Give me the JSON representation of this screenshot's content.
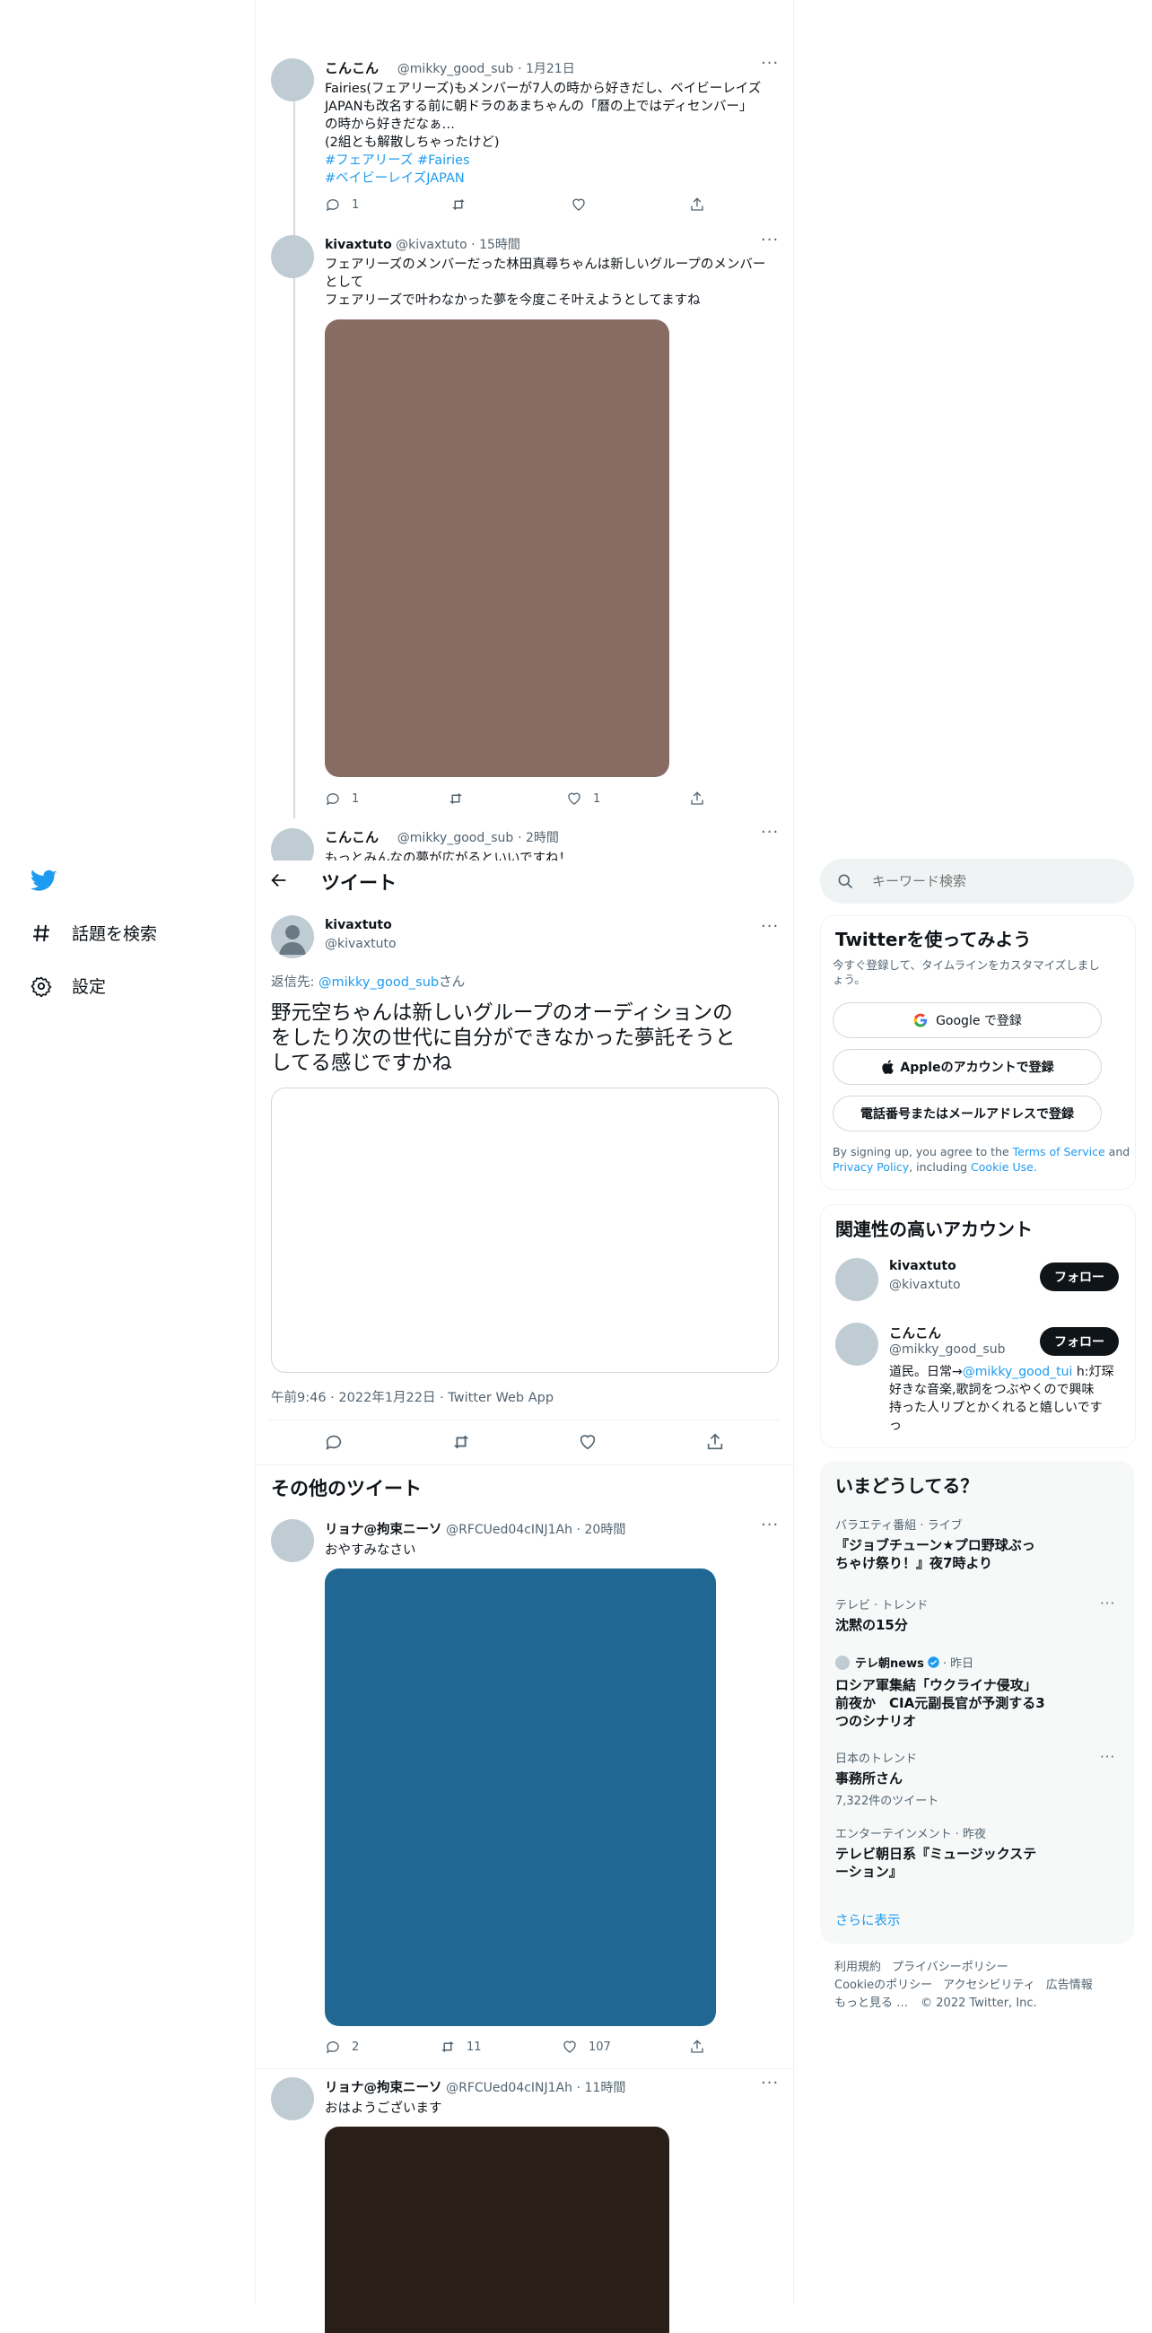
{
  "colors": {
    "accent": "#1d9bf0",
    "text": "#0f1419",
    "muted": "#536471",
    "media1": "#886b63",
    "media2": "#206893",
    "media3": "#2a1f18"
  },
  "thread_tweets": [
    {
      "name": "こんこん",
      "handle": "@mikky_good_sub",
      "time": "· 1月21日",
      "lines": [
        "Fairies(フェアリーズ)もメンバーが7人の時から好きだし、ベイビーレイズ",
        "JAPANも改名する前に朝ドラのあまちゃんの「暦の上ではディセンバー」",
        "の時から好きだなぁ…",
        "(2組とも解散しちゃったけど)"
      ],
      "hashtags1": "#フェアリーズ #Fairies",
      "hashtags2": "#ベイビーレイズJAPAN",
      "replies": "1",
      "likes": ""
    },
    {
      "name": "kivaxtuto",
      "handle": "@kivaxtuto",
      "time": "· 15時間",
      "lines": [
        "フェアリーズのメンバーだった林田真尋ちゃんは新しいグループのメンバー",
        "として",
        "フェアリーズで叶わなかった夢を今度こそ叶えようとしてますね"
      ],
      "replies": "1",
      "likes": "1"
    },
    {
      "name": "こんこん",
      "handle": "@mikky_good_sub",
      "time": "· 2時間",
      "partial": "もっとみんなの夢が広がるといいですね！"
    }
  ],
  "nav": {
    "search": "話題を検索",
    "settings": "設定"
  },
  "header": {
    "title": "ツイート"
  },
  "main_tweet": {
    "name": "kivaxtuto",
    "handle": "@kivaxtuto",
    "reply_prefix": "返信先: ",
    "reply_to": "@mikky_good_sub",
    "reply_suffix": "さん",
    "text_lines": [
      "野元空ちゃんは新しいグループのオーディションの",
      "をしたり次の世代に自分ができなかった夢託そうと",
      "してる感じですかね"
    ],
    "meta": "午前9:46 · 2022年1月22日 · Twitter Web App"
  },
  "more_tweets": {
    "heading": "その他のツイート",
    "items": [
      {
        "name": "リョナ@拘束ニーソ",
        "handle": "@RFCUed04cINJ1Ah",
        "time": "· 20時間",
        "text": "おやすみなさい",
        "replies": "2",
        "retweets": "11",
        "likes": "107"
      },
      {
        "name": "リョナ@拘束ニーソ",
        "handle": "@RFCUed04cINJ1Ah",
        "time": "· 11時間",
        "text": "おはようございます"
      }
    ]
  },
  "search": {
    "placeholder": "キーワード検索"
  },
  "signup": {
    "title": "Twitterを使ってみよう",
    "subtitle_lines": [
      "今すぐ登録して、タイムラインをカスタマイズしまし",
      "ょう。"
    ],
    "google": "Google で登録",
    "apple": "Appleのアカウントで登録",
    "phone": "電話番号またはメールアドレスで登録",
    "legal_1": "By signing up, you agree to the ",
    "terms": "Terms of Service",
    "and": " and",
    "privacy": "Privacy Policy",
    "including": ", including ",
    "cookie": "Cookie Use."
  },
  "relevant": {
    "title": "関連性の高いアカウント",
    "follow": "フォロー",
    "accounts": [
      {
        "name": "kivaxtuto",
        "handle": "@kivaxtuto"
      },
      {
        "name": "こんこん",
        "handle": "@mikky_good_sub",
        "bio_1a": "道民。日常→",
        "bio_link": "@mikky_good_tui",
        "bio_1b": " h:灯琛",
        "bio_2": "好きな音楽,歌詞をつぶやくので興味",
        "bio_3": "持った人リプとかくれると嬉しいです",
        "bio_4": "っ"
      }
    ]
  },
  "trends": {
    "title": "いまどうしてる？",
    "items": [
      {
        "category": "バラエティ番組 · ライブ",
        "title_1": "『ジョブチューン★プロ野球ぶっ",
        "title_2": "ちゃけ祭り！』夜7時より"
      },
      {
        "category": "テレビ · トレンド",
        "title_1": "沈黙の15分"
      },
      {
        "source": "テレ朝news",
        "source_time": "· 昨日",
        "title_1": "ロシア軍集結「ウクライナ侵攻」",
        "title_2": "前夜か　CIA元副長官が予測する3",
        "title_3": "つのシナリオ"
      },
      {
        "category": "日本のトレンド",
        "title_1": "事務所さん",
        "count": "7,322件のツイート"
      },
      {
        "category": "エンターテインメント · 昨夜",
        "title_1": "テレビ朝日系『ミュージックステ",
        "title_2": "ーション』"
      }
    ],
    "show_more": "さらに表示"
  },
  "footer": {
    "terms": "利用規約",
    "privacy": "プライバシーポリシー",
    "cookie": "Cookieのポリシー",
    "accessibility": "アクセシビリティ",
    "ads": "広告情報",
    "more": "もっと見る …",
    "copyright": "© 2022 Twitter, Inc."
  }
}
